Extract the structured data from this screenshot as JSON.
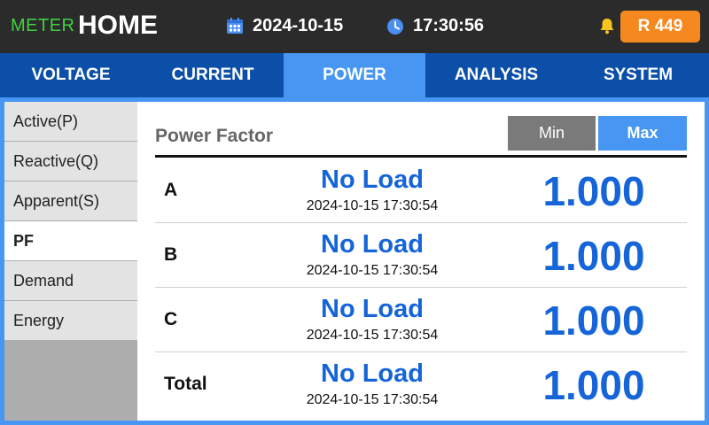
{
  "header": {
    "brand_prefix": "METER",
    "brand_title": "HOME",
    "date": "2024-10-15",
    "time": "17:30:56",
    "badge": "R 449"
  },
  "tabs": [
    {
      "label": "VOLTAGE",
      "active": false
    },
    {
      "label": "CURRENT",
      "active": false
    },
    {
      "label": "POWER",
      "active": true
    },
    {
      "label": "ANALYSIS",
      "active": false
    },
    {
      "label": "SYSTEM",
      "active": false
    }
  ],
  "sidebar": {
    "items": [
      {
        "label": "Active(P)",
        "active": false
      },
      {
        "label": "Reactive(Q)",
        "active": false
      },
      {
        "label": "Apparent(S)",
        "active": false
      },
      {
        "label": "PF",
        "active": true
      },
      {
        "label": "Demand",
        "active": false
      },
      {
        "label": "Energy",
        "active": false
      }
    ]
  },
  "panel": {
    "title": "Power Factor",
    "min_label": "Min",
    "max_label": "Max",
    "selected": "Max",
    "rows": [
      {
        "phase": "A",
        "status": "No Load",
        "timestamp": "2024-10-15 17:30:54",
        "value": "1.000"
      },
      {
        "phase": "B",
        "status": "No Load",
        "timestamp": "2024-10-15 17:30:54",
        "value": "1.000"
      },
      {
        "phase": "C",
        "status": "No Load",
        "timestamp": "2024-10-15 17:30:54",
        "value": "1.000"
      },
      {
        "phase": "Total",
        "status": "No Load",
        "timestamp": "2024-10-15 17:30:54",
        "value": "1.000"
      }
    ]
  },
  "colors": {
    "topbar": "#2b2b2b",
    "brand_green": "#3fd13f",
    "badge_orange": "#f5891f",
    "nav_blue": "#0b4fa8",
    "accent_blue": "#4696f2",
    "value_blue": "#1565d8",
    "bell_yellow": "#f7c520"
  },
  "icons": {
    "date": "calendar-icon",
    "time": "clock-icon",
    "alarm": "bell-icon"
  }
}
